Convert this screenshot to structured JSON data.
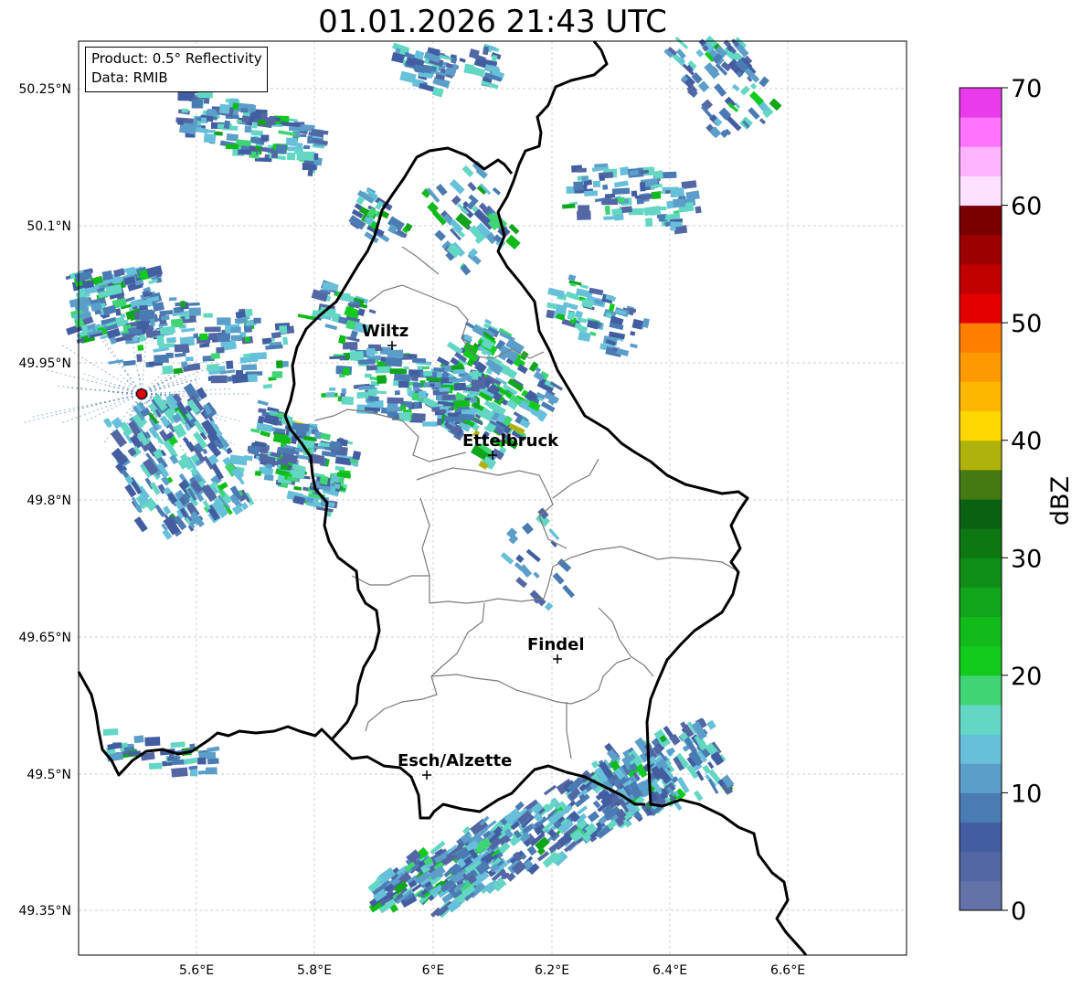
{
  "title": "01.01.2026 21:43 UTC",
  "info": {
    "product": "Product: 0.5° Reflectivity",
    "data": "Data: RMIB"
  },
  "axes": {
    "lat_labels": [
      "50.25°N",
      "50.1°N",
      "49.95°N",
      "49.8°N",
      "49.65°N",
      "49.5°N",
      "49.35°N"
    ],
    "lon_labels": [
      "5.6°E",
      "5.8°E",
      "6°E",
      "6.2°E",
      "6.4°E",
      "6.6°E"
    ],
    "grid": true
  },
  "cities": [
    {
      "name": "Wiltz"
    },
    {
      "name": "Ettelbruck"
    },
    {
      "name": "Findel"
    },
    {
      "name": "Esch/Alzette"
    }
  ],
  "colorbar": {
    "unit": "dBZ",
    "ticks": [
      "0",
      "10",
      "20",
      "30",
      "40",
      "50",
      "60",
      "70"
    ],
    "colors": [
      "#6373a8",
      "#5267a3",
      "#435da1",
      "#4a7bb3",
      "#5b9ec9",
      "#67c0da",
      "#63d7c4",
      "#40d474",
      "#11cb1d",
      "#11bb1b",
      "#10a51a",
      "#0f8d16",
      "#0d7711",
      "#0a6111",
      "#457a12",
      "#afb20a",
      "#fed800",
      "#feb700",
      "#fe9a00",
      "#ff7e00",
      "#e50000",
      "#c10000",
      "#9c0000",
      "#780000",
      "#ffe0ff",
      "#ffb3ff",
      "#ff73ff",
      "#e93bec"
    ],
    "min": 0,
    "max": 70
  },
  "radar_site_color": "#e00000"
}
